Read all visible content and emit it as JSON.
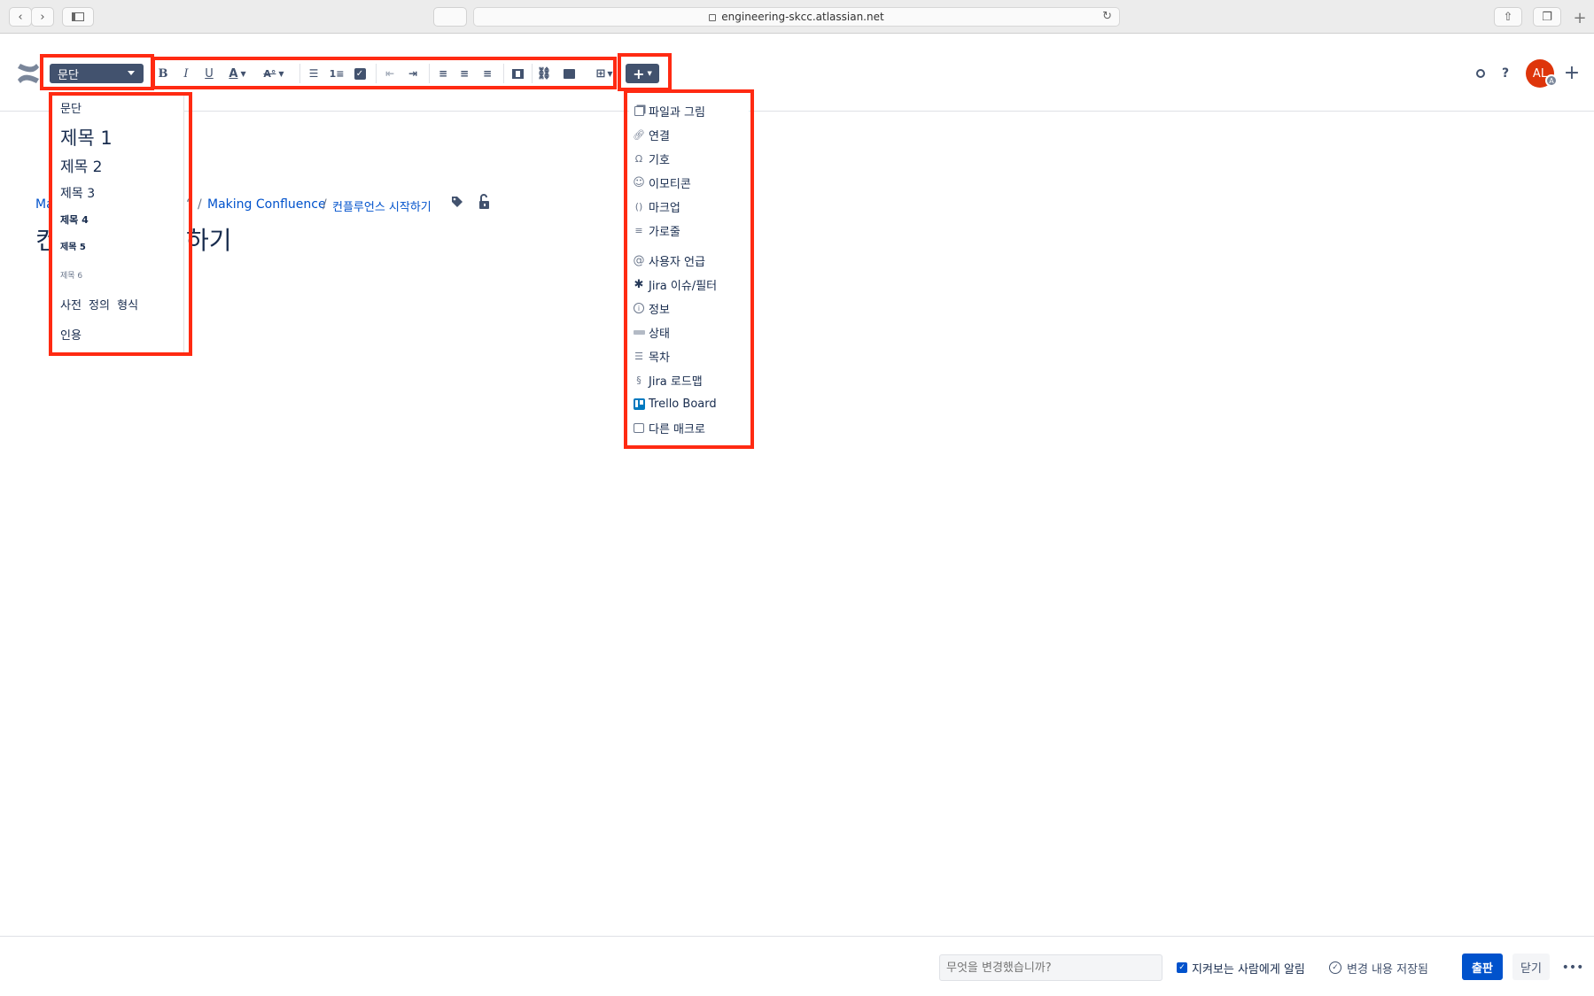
{
  "browser": {
    "url": "engineering-skcc.atlassian.net"
  },
  "toolbar": {
    "paragraph_style": "문단",
    "insert_label": "+",
    "user_initials": "AL",
    "user_badge": "A",
    "help_label": "?"
  },
  "style_menu": {
    "items": [
      "문단",
      "제목 1",
      "제목 2",
      "제목 3",
      "제목 4",
      "제목 5",
      "제목 6",
      "사전 정의 형식",
      "인용"
    ]
  },
  "insert_menu": {
    "items": [
      {
        "label": "파일과 그림",
        "icon": "files-images-icon"
      },
      {
        "label": "연결",
        "icon": "link-icon"
      },
      {
        "label": "기호",
        "icon": "omega-symbol-icon"
      },
      {
        "label": "이모티콘",
        "icon": "smiley-icon"
      },
      {
        "label": "마크업",
        "icon": "markup-braces-icon"
      },
      {
        "label": "가로줄",
        "icon": "horizontal-rule-icon"
      },
      {
        "label": "사용자 언급",
        "icon": "at-mention-icon"
      },
      {
        "label": "Jira 이슈/필터",
        "icon": "jira-icon"
      },
      {
        "label": "정보",
        "icon": "info-icon"
      },
      {
        "label": "상태",
        "icon": "status-lozenge-icon"
      },
      {
        "label": "목차",
        "icon": "table-of-contents-icon"
      },
      {
        "label": "Jira 로드맵",
        "icon": "jira-roadmap-icon"
      },
      {
        "label": "Trello Board",
        "icon": "trello-icon"
      },
      {
        "label": "다른 매크로",
        "icon": "macro-icon"
      }
    ]
  },
  "page": {
    "breadcrumb_prefix": "Ma",
    "breadcrumb_items": [
      "Making Confluence",
      "컨플루언스 시작하기"
    ],
    "title_left": "컨",
    "title_right": "하기"
  },
  "footer": {
    "comment_placeholder": "무엇을 변경했습니까?",
    "notify_label": "지켜보는 사람에게 알림",
    "saved_label": "변경 내용 저장됨",
    "publish_label": "출판",
    "close_label": "닫기",
    "more_label": "•••"
  },
  "colors": {
    "highlight_red": "#ff2a12",
    "primary_blue": "#0052cc",
    "toolbar_dark": "#42526e",
    "avatar_red": "#de350b"
  }
}
